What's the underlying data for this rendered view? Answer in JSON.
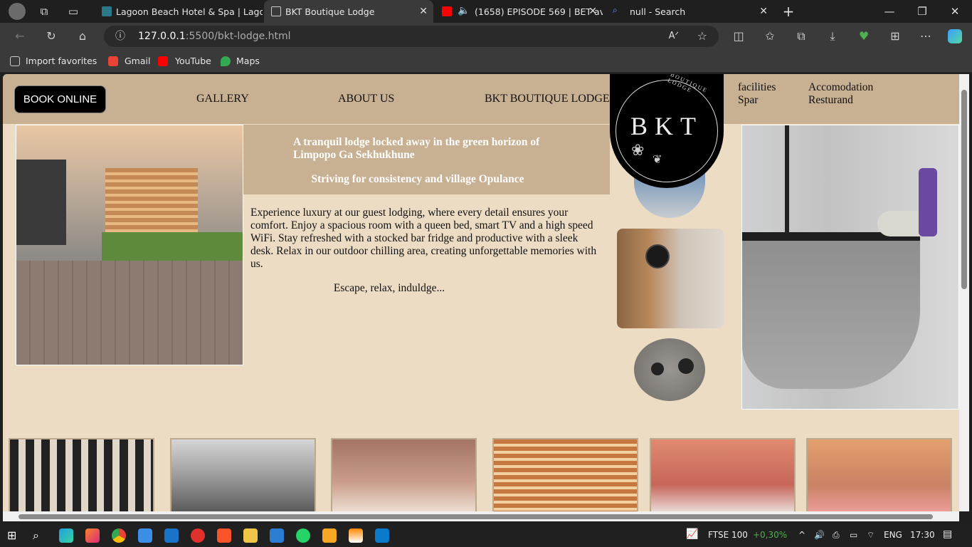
{
  "browser": {
    "tabs": [
      {
        "title": "Lagoon Beach Hotel & Spa | Lago",
        "close": "✕"
      },
      {
        "title": "BKT Boutique Lodge",
        "close": "✕"
      },
      {
        "title": "(1658) EPISODE 569 | BET av",
        "close": "✕"
      },
      {
        "title": "null - Search",
        "close": "✕"
      }
    ],
    "new_tab": "+",
    "window_controls": {
      "minimize": "—",
      "restore": "❐",
      "close": "✕"
    },
    "address": {
      "host": "127.0.0.1",
      "path": ":5500/bkt-lodge.html"
    },
    "favorites": [
      {
        "label": "Import favorites",
        "icon": "import-icon",
        "color": "#cccccc"
      },
      {
        "label": "Gmail",
        "icon": "gmail-icon",
        "color": "#ea4335"
      },
      {
        "label": "YouTube",
        "icon": "youtube-icon",
        "color": "#ff0000"
      },
      {
        "label": "Maps",
        "icon": "maps-icon",
        "color": "#34a853"
      }
    ]
  },
  "site": {
    "book_online": "BOOK ONLINE",
    "nav": {
      "gallery": "GALLERY",
      "about": "ABOUT US",
      "lodge": "BKT BOUTIQUE LODGE",
      "facilities": "facilities",
      "spar": "Spar",
      "accomodation": "Accomodation",
      "resturand": "Resturand"
    },
    "logo": {
      "letters": "BKT",
      "arc_text": "BOUTIQUE LODGE"
    },
    "tagline_1": "A tranquil lodge locked away in the green horizon of Limpopo Ga Sekhukhune",
    "tagline_2": "Striving for consistency and village Opulance",
    "description": "Experience luxury at our guest lodging, where every detail ensures your comfort. Enjoy a spacious room with a queen bed, smart TV and a high speed WiFi. Stay refreshed with a stocked bar fridge and productive with a sleek desk. Relax in our outdoor chilling area, creating unforgettable memories with us.",
    "escape": "Escape, relax, induldge...",
    "colors": {
      "header": "#c8b092",
      "page": "#ecdcc4",
      "button": "#000000"
    }
  },
  "taskbar": {
    "ticker": "FTSE 100",
    "ticker_change": "+0,30%",
    "language": "ENG",
    "time": "17:30"
  }
}
